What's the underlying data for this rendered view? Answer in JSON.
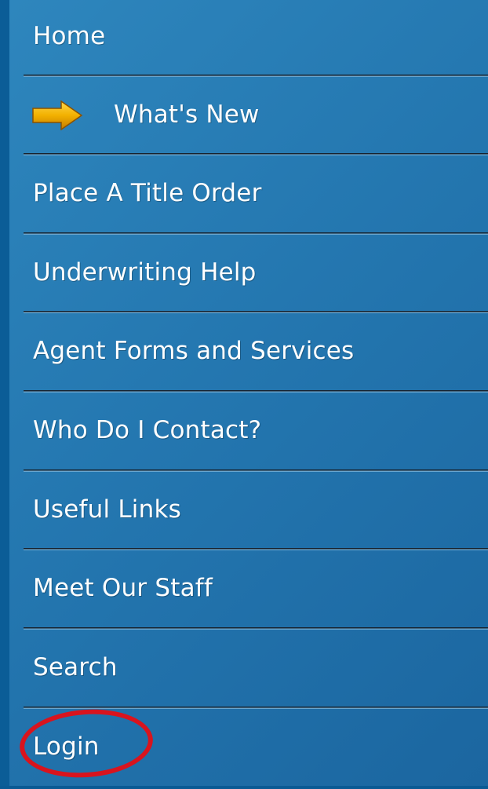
{
  "nav": {
    "items": [
      {
        "label": "Home"
      },
      {
        "label": "What's New",
        "icon": "arrow-right-icon"
      },
      {
        "label": "Place A Title Order"
      },
      {
        "label": "Underwriting Help"
      },
      {
        "label": "Agent Forms and Services"
      },
      {
        "label": "Who Do I Contact?"
      },
      {
        "label": "Useful Links"
      },
      {
        "label": "Meet Our Staff"
      },
      {
        "label": "Search"
      },
      {
        "label": "Login"
      }
    ],
    "highlight": "Login"
  },
  "colors": {
    "background": "#2477b0",
    "text": "#ffffff",
    "arrow": "#f2b000",
    "highlight_ring": "#d8141e"
  }
}
